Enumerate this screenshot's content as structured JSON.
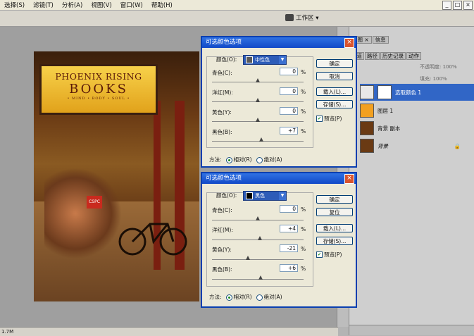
{
  "menubar": {
    "items": [
      "选择(S)",
      "滤镜(T)",
      "分析(A)",
      "视图(V)",
      "窗口(W)",
      "帮助(H)"
    ],
    "window_buttons": [
      "_",
      "□",
      "×"
    ]
  },
  "options_bar": {
    "workspace_label": "工作区 ▾"
  },
  "statusbar": {
    "zoom_text": "1.7M"
  },
  "photo": {
    "sign_line1": "PHOENIX RISING",
    "sign_line2": "BOOKS",
    "sign_line3": "• MIND • BODY • SOUL •",
    "shirt_text": "CSPC"
  },
  "layers_panel": {
    "tabs_top": [
      "方图 ×",
      "信息"
    ],
    "tabs": [
      "通道",
      "路径",
      "历史记录",
      "动作"
    ],
    "opacity_label": "不透明度: 100%",
    "fill_label": "填充: 100%",
    "layers": [
      {
        "name": "选取颜色 1",
        "selected": true,
        "thumb_color": "#e8e8e8"
      },
      {
        "name": "图层 1",
        "selected": false,
        "thumb_color": "#f2a020"
      },
      {
        "name": "背景 副本",
        "selected": false,
        "thumb_color": "#6a3a14"
      },
      {
        "name": "背景",
        "selected": false,
        "thumb_color": "#6a3a14"
      }
    ]
  },
  "dialog1": {
    "title": "可选颜色选项",
    "colors_label": "颜色(O):",
    "colors_value": "中性色",
    "swatch": "#5a5a5a",
    "sliders": [
      {
        "label": "青色(C):",
        "value": "0",
        "thumb_frac": 0.5
      },
      {
        "label": "洋红(M):",
        "value": "0",
        "thumb_frac": 0.5
      },
      {
        "label": "黄色(Y):",
        "value": "0",
        "thumb_frac": 0.5
      },
      {
        "label": "黑色(B):",
        "value": "+7",
        "thumb_frac": 0.535
      }
    ],
    "pct": "%",
    "buttons": [
      "确定",
      "取消",
      "载入(L)...",
      "存储(S)..."
    ],
    "preview_label": "预览(P)",
    "method_label": "方法:",
    "method_relative": "相对(R)",
    "method_absolute": "绝对(A)"
  },
  "dialog2": {
    "title": "可选颜色选项",
    "colors_label": "颜色(O):",
    "colors_value": "黑色",
    "swatch": "#000000",
    "sliders": [
      {
        "label": "青色(C):",
        "value": "0",
        "thumb_frac": 0.5
      },
      {
        "label": "洋红(M):",
        "value": "+4",
        "thumb_frac": 0.52
      },
      {
        "label": "黄色(Y):",
        "value": "-21",
        "thumb_frac": 0.395
      },
      {
        "label": "黑色(B):",
        "value": "+6",
        "thumb_frac": 0.53
      }
    ],
    "pct": "%",
    "buttons": [
      "确定",
      "复位",
      "载入(L)...",
      "存储(S)..."
    ],
    "preview_label": "预览(P)",
    "method_label": "方法:",
    "method_relative": "相对(R)",
    "method_absolute": "绝对(A)"
  }
}
